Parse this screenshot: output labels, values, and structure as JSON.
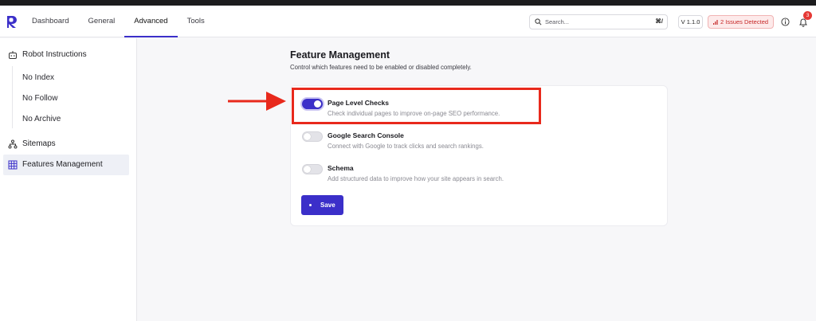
{
  "header": {
    "nav": [
      {
        "label": "Dashboard",
        "active": false
      },
      {
        "label": "General",
        "active": false
      },
      {
        "label": "Advanced",
        "active": true
      },
      {
        "label": "Tools",
        "active": false
      }
    ],
    "search": {
      "placeholder": "Search...",
      "shortcut": "⌘/"
    },
    "version": "V 1.1.0",
    "issues_label": "2 Issues Detected",
    "notification_count": "3"
  },
  "sidebar": {
    "robot_label": "Robot Instructions",
    "robot_sub": [
      "No Index",
      "No Follow",
      "No Archive"
    ],
    "sitemaps_label": "Sitemaps",
    "features_label": "Features Management"
  },
  "main": {
    "title": "Feature Management",
    "description": "Control which features need to be enabled or disabled completely.",
    "features": [
      {
        "title": "Page Level Checks",
        "description": "Check individual pages to improve on-page SEO performance.",
        "enabled": true
      },
      {
        "title": "Google Search Console",
        "description": "Connect with Google to track clicks and search rankings.",
        "enabled": false
      },
      {
        "title": "Schema",
        "description": "Add structured data to improve how your site appears in search.",
        "enabled": false
      }
    ],
    "save_label": "Save"
  },
  "colors": {
    "accent": "#3b2fc9",
    "annotation": "#e8291c",
    "issue": "#c62828"
  }
}
